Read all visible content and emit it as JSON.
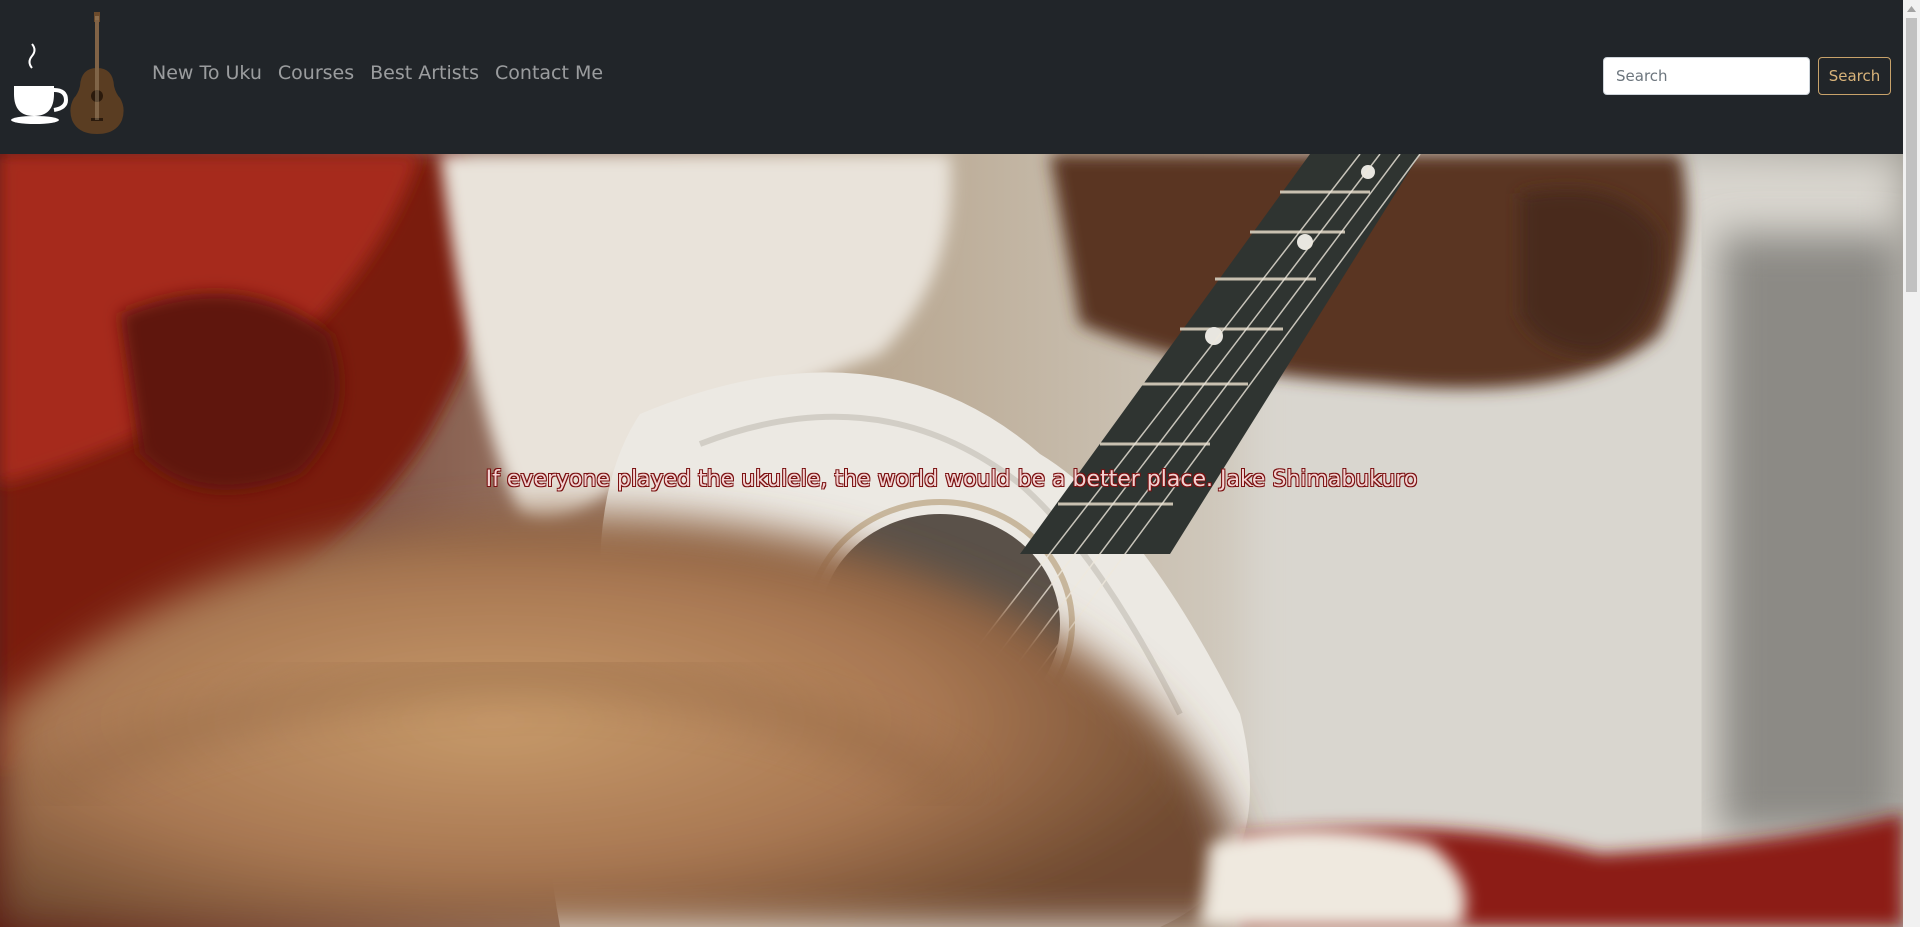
{
  "navbar": {
    "logo": {
      "icons": [
        "coffee-cup-icon",
        "ukulele-icon"
      ]
    },
    "links": [
      {
        "label": "New To Uku"
      },
      {
        "label": "Courses"
      },
      {
        "label": "Best Artists"
      },
      {
        "label": "Contact Me"
      }
    ],
    "search": {
      "placeholder": "Search",
      "value": "",
      "button_label": "Search"
    }
  },
  "hero": {
    "quote": "If everyone played the ukulele, the world would be a better place. Jake Shimabukuro",
    "image_subject": "hands playing a white ukulele"
  },
  "colors": {
    "navbar_bg": "#212529",
    "nav_link": "rgba(255,255,255,0.55)",
    "search_button_accent": "#d8b37a",
    "quote_text": "#f3d2d2",
    "quote_outline": "#7a1010"
  }
}
